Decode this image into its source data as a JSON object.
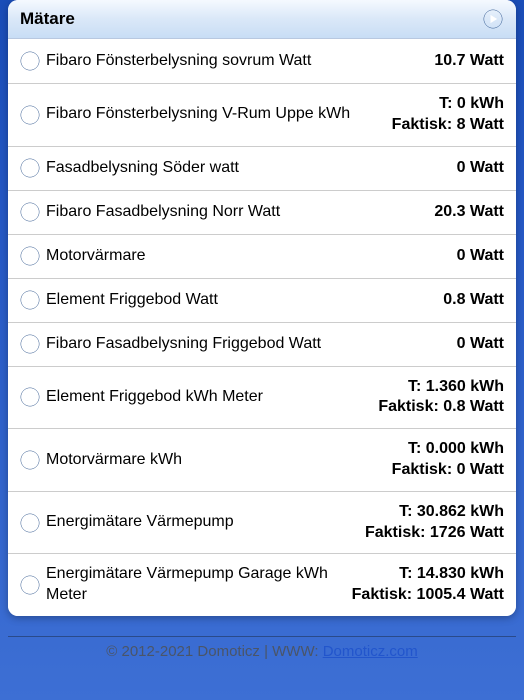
{
  "header": {
    "title": "Mätare"
  },
  "meters": [
    {
      "label": "Fibaro Fönsterbelysning sovrum Watt",
      "value": "10.7 Watt"
    },
    {
      "label": "Fibaro Fönsterbelysning V-Rum Uppe kWh",
      "value": "T: 0 kWh\nFaktisk: 8 Watt"
    },
    {
      "label": "Fasadbelysning Söder watt",
      "value": "0 Watt"
    },
    {
      "label": "Fibaro Fasadbelysning Norr Watt",
      "value": "20.3 Watt"
    },
    {
      "label": "Motorvärmare",
      "value": "0 Watt"
    },
    {
      "label": "Element Friggebod Watt",
      "value": "0.8 Watt"
    },
    {
      "label": "Fibaro Fasadbelysning Friggebod Watt",
      "value": "0 Watt"
    },
    {
      "label": "Element Friggebod kWh Meter",
      "value": "T: 1.360 kWh\nFaktisk: 0.8 Watt"
    },
    {
      "label": "Motorvärmare kWh",
      "value": "T: 0.000 kWh\nFaktisk: 0 Watt"
    },
    {
      "label": "Energimätare Värmepump",
      "value": "T: 30.862 kWh\nFaktisk: 1726 Watt"
    },
    {
      "label": "Energimätare Värmepump Garage kWh Meter",
      "value": "T: 14.830 kWh\nFaktisk: 1005.4 Watt"
    }
  ],
  "footer": {
    "copyright": "© 2012-2021 Domoticz | WWW: ",
    "link_text": "Domoticz.com"
  }
}
